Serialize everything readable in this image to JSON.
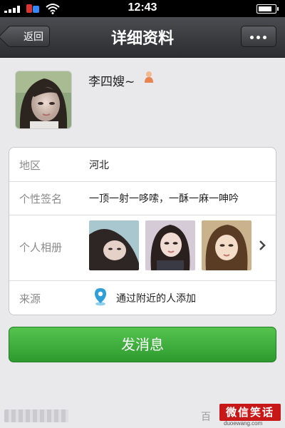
{
  "status_bar": {
    "time": "12:43",
    "signal_bars": 4,
    "battery_level": 0.9
  },
  "nav": {
    "title": "详细资料",
    "back_label": "返回",
    "more_icon": "ellipsis-icon"
  },
  "profile": {
    "name": "李四嫂~",
    "gender_icon": "female-icon"
  },
  "info": {
    "region": {
      "label": "地区",
      "value": "河北"
    },
    "signature": {
      "label": "个性签名",
      "value": "一顶一射一哆嗦，一酥一麻一呻吟"
    },
    "album": {
      "label": "个人相册",
      "photo_count": 3
    },
    "source": {
      "label": "来源",
      "value": "通过附近的人添加",
      "icon": "location-pin-icon"
    }
  },
  "send_button_label": "发消息",
  "watermark": {
    "logo_text": "微信笑话",
    "domain": "duoewang.com",
    "baidu": "百"
  },
  "colors": {
    "nav_bg": "#2c2d30",
    "send_green": "#3aab37",
    "label_gray": "#8a8a8a",
    "watermark_red": "#c81717"
  }
}
